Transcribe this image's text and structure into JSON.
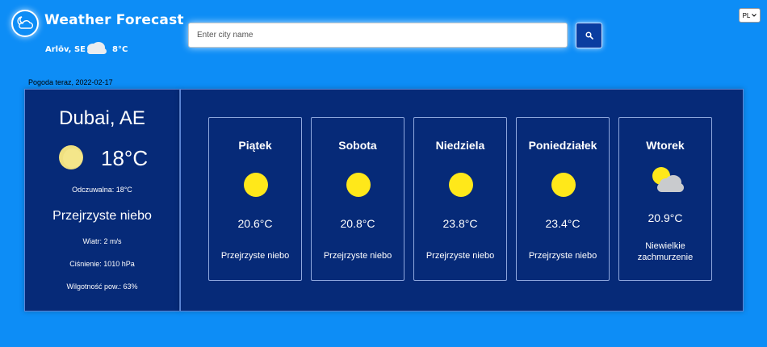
{
  "header": {
    "title": "Weather Forecast",
    "logo_icon": "cloud-moon-icon",
    "location": {
      "name": "Arlöv, SE",
      "temp": "8°C",
      "icon": "cloud-icon"
    }
  },
  "search": {
    "placeholder": "Enter city name",
    "value": "",
    "button_icon": "search-icon"
  },
  "language": {
    "selected": "PL"
  },
  "current": {
    "date_label": "Pogoda teraz, 2022-02-17",
    "city": "Dubai, AE",
    "temp": "18°C",
    "icon": "sun-icon",
    "feels_like": "Odczuwalna: 18°C",
    "description": "Przejrzyste niebo",
    "wind": "Wiatr: 2 m/s",
    "pressure": "Ciśnienie: 1010 hPa",
    "humidity": "Wilgotność pow.: 63%"
  },
  "forecast": [
    {
      "day": "Piątek",
      "temp": "20.6°C",
      "description": "Przejrzyste niebo",
      "icon": "sun-icon"
    },
    {
      "day": "Sobota",
      "temp": "20.8°C",
      "description": "Przejrzyste niebo",
      "icon": "sun-icon"
    },
    {
      "day": "Niedziela",
      "temp": "23.8°C",
      "description": "Przejrzyste niebo",
      "icon": "sun-icon"
    },
    {
      "day": "Poniedziałek",
      "temp": "23.4°C",
      "description": "Przejrzyste niebo",
      "icon": "sun-icon"
    },
    {
      "day": "Wtorek",
      "temp": "20.9°C",
      "description": "Niewielkie zachmurzenie",
      "icon": "sun-behind-cloud-icon"
    }
  ],
  "colors": {
    "background": "#0d8df6",
    "panel": "#062a78",
    "search_button": "#0a3da0",
    "sun": "#ffe81a"
  }
}
